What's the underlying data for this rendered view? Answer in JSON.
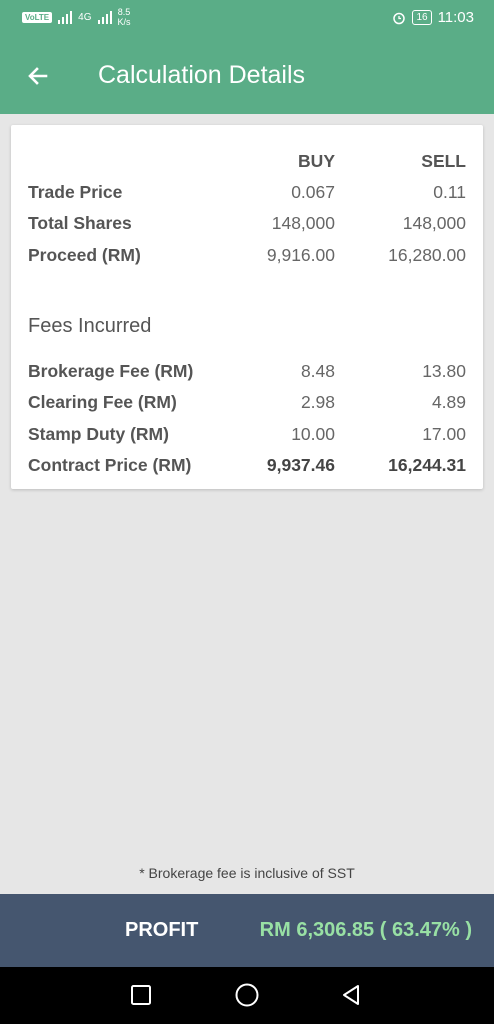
{
  "statusbar": {
    "volte": "VoLTE",
    "network": "4G",
    "speed_value": "8.5",
    "speed_unit": "K/s",
    "battery": "16",
    "time": "11:03"
  },
  "appbar": {
    "title": "Calculation Details"
  },
  "table": {
    "col_buy": "BUY",
    "col_sell": "SELL",
    "rows": [
      {
        "label": "Trade Price",
        "buy": "0.067",
        "sell": "0.11"
      },
      {
        "label": "Total Shares",
        "buy": "148,000",
        "sell": "148,000"
      },
      {
        "label": "Proceed (RM)",
        "buy": "9,916.00",
        "sell": "16,280.00"
      }
    ]
  },
  "fees": {
    "title": "Fees Incurred",
    "rows": [
      {
        "label": "Brokerage Fee (RM)",
        "buy": "8.48",
        "sell": "13.80"
      },
      {
        "label": "Clearing Fee (RM)",
        "buy": "2.98",
        "sell": "4.89"
      },
      {
        "label": "Stamp Duty (RM)",
        "buy": "10.00",
        "sell": "17.00"
      },
      {
        "label": "Contract Price (RM)",
        "buy": "9,937.46",
        "sell": "16,244.31"
      }
    ]
  },
  "note": "*   Brokerage fee is inclusive of SST",
  "profit": {
    "label": "PROFIT",
    "value": "RM 6,306.85 ( 63.47% )"
  },
  "colors": {
    "primary": "#5aad87",
    "profit_bar": "#45566f",
    "profit_value": "#98e0a4"
  },
  "icons": {
    "back": "arrow-left-icon",
    "recents": "square-icon",
    "home": "circle-icon",
    "back_nav": "triangle-back-icon"
  }
}
